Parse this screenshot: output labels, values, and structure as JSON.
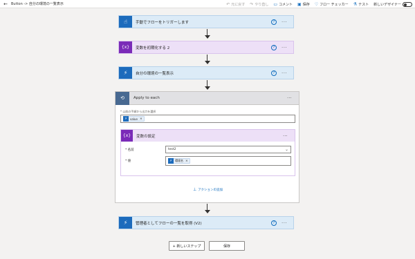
{
  "topbar": {
    "back_icon": "back-arrow-icon",
    "title": "Button -> 自分の環境の一覧表示",
    "commands": [
      {
        "name": "undo",
        "label": "元に戻す",
        "icon": "↶",
        "disabled": true
      },
      {
        "name": "redo",
        "label": "やり直し",
        "icon": "↷",
        "disabled": true
      },
      {
        "name": "comment",
        "label": "コメント",
        "icon": "▭",
        "disabled": false
      },
      {
        "name": "save",
        "label": "保存",
        "icon": "▣",
        "disabled": false
      },
      {
        "name": "flow-checker",
        "label": "フロー チェッカー",
        "icon": "♡",
        "disabled": false
      },
      {
        "name": "test",
        "label": "テスト",
        "icon": "⚗",
        "disabled": false
      }
    ],
    "new_designer_label": "新しいデザイナー",
    "new_designer_on": false
  },
  "steps": {
    "trigger": {
      "label": "手動でフローをトリガーします",
      "icon": "☝"
    },
    "init_var": {
      "label": "変数を初期化する 2",
      "icon": "{x}"
    },
    "list_env": {
      "label": "自分の環境の一覧表示",
      "icon": "⚡"
    },
    "get_flows": {
      "label": "管理者としてフローの一覧を取得 (V2)",
      "icon": "⚡"
    }
  },
  "apply_each": {
    "title": "Apply to each",
    "icon": "⟲",
    "select_label": "* 以前の手順から出力を選択",
    "select_token": {
      "label": "value",
      "icon": "⚡"
    },
    "set_var": {
      "title": "変数の設定",
      "icon": "{x}",
      "name_label": "* 名前",
      "name_value": "test2",
      "value_label": "* 値",
      "value_token": {
        "label": "環境名",
        "icon": "⚡"
      }
    },
    "add_action": "アクションの追加"
  },
  "buttons": {
    "new_step": "+ 新しいステップ",
    "save": "保存"
  },
  "colors": {
    "blue_card": "#dcebf7",
    "blue_icon": "#1c6bbc",
    "purple_card": "#ede0f7",
    "purple_icon": "#7a2bb8",
    "loop_header": "#486991"
  }
}
